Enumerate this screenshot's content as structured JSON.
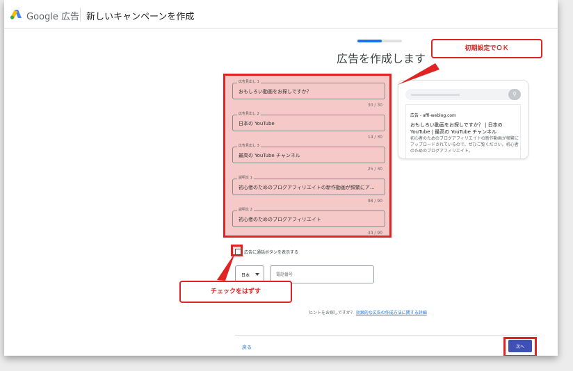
{
  "header": {
    "brand": "Google 広告",
    "title": "新しいキャンペーンを作成"
  },
  "progress": {
    "fraction": 0.55
  },
  "heading": "広告を作成します",
  "fields": [
    {
      "label": "広告見出し 1",
      "value": "おもしろい動画をお探しですか？",
      "counter": "30 / 30"
    },
    {
      "label": "広告見出し 2",
      "value": "日本の YouTube",
      "counter": "14 / 30"
    },
    {
      "label": "広告見出し 3",
      "value": "最高の YouTube チャンネル",
      "counter": "25 / 30"
    },
    {
      "label": "説明文 1",
      "value": "初心者のためのブログアフィリエイトの新作動画が頻繁にア...",
      "counter": "98 / 90"
    },
    {
      "label": "説明文 2",
      "value": "初心者のためのブログアフィリエイト",
      "counter": "34 / 90"
    }
  ],
  "preview": {
    "domain": "広告 - affi-weblog.com",
    "headline": "おもしろい動画をお探しですか？ | 日本の YouTube | 最高の YouTube チャンネル",
    "description": "初心者のためのブログアフィリエイトの新作動画が頻繁にアップロードされているので、ぜひご覧ください。初心者のためのブログアフィリエイト。"
  },
  "annotations": {
    "defaults_ok": "初期設定でＯＫ",
    "uncheck": "チェックをはずす"
  },
  "call_button": {
    "checkbox_label": "広告に通話ボタンを表示する",
    "checked": false,
    "country": "日本",
    "phone_placeholder": "電話番号"
  },
  "hint": {
    "text": "ヒントをお探しですか？",
    "link": "効果的な広告の作成方法に関する詳細"
  },
  "footer": {
    "back": "戻る",
    "next": "次へ"
  },
  "colors": {
    "accent": "#1a73e8",
    "annotation_red": "#e02424",
    "next_button": "#3f51b5"
  }
}
